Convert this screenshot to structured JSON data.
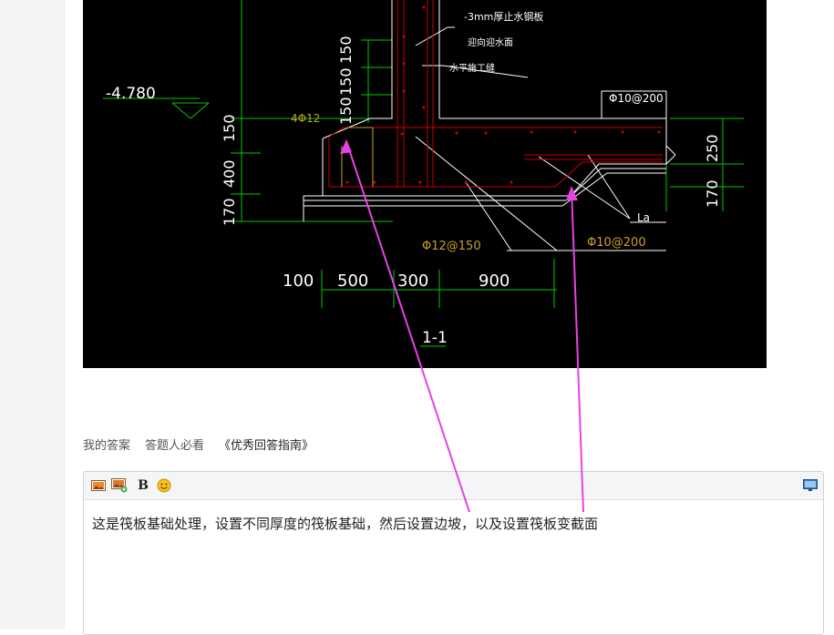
{
  "drawing": {
    "section_label": "1-1",
    "elevation": "-4.780",
    "note_steel_plate": "-3mm厚止水钢板",
    "note_waterproof": "迎向迎水面",
    "note_joint": "水平施工缝",
    "rebar_top": "Φ10@200",
    "rebar_bottom_left": "Φ12@150",
    "rebar_bottom_right": "Φ10@200",
    "rebar_corner": "4Φ12",
    "anchor_label": "La",
    "dims_horizontal": [
      "100",
      "500",
      "300",
      "900"
    ],
    "dims_left_vertical": [
      "150",
      "150",
      "150",
      "150",
      "400",
      "170"
    ],
    "dims_right_vertical": [
      "250",
      "170"
    ]
  },
  "answer_bar": {
    "my_answer": "我的答案",
    "must_read": "答题人必看",
    "guide": "《优秀回答指南》"
  },
  "editor": {
    "content": "这是筏板基础处理，设置不同厚度的筏板基础，然后设置边坡，以及设置筏板变截面"
  },
  "toolbar": {
    "bold_label": "B",
    "icons": [
      "image-icon",
      "insert-image-icon",
      "bold-icon",
      "emoji-icon",
      "preview-icon"
    ]
  },
  "colors": {
    "cad_background": "#000000",
    "cad_line_white": "#ffffff",
    "cad_line_green": "#00c800",
    "cad_line_red": "#cc0000",
    "cad_line_yellow": "#c8a028",
    "annotation_arrow": "#e642e6"
  }
}
